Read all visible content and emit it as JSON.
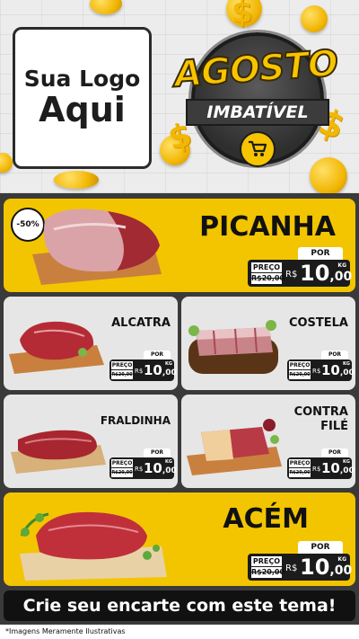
{
  "logo": {
    "line1": "Sua Logo",
    "line2": "Aqui"
  },
  "badge": {
    "title": "AGOSTO",
    "subtitle": "IMBATÍVEL",
    "icon": "shopping-cart-icon"
  },
  "labels": {
    "por": "POR",
    "preco": "PREÇO",
    "currency": "R$",
    "unit": "KG"
  },
  "colors": {
    "accent": "#f2c500",
    "dark": "#1b1b1b",
    "light_card": "#e6e6e6"
  },
  "featured": [
    {
      "name": "PICANHA",
      "discount": "-50%",
      "old_price": "R$20,00",
      "price_int": "10",
      "price_dec": ",00"
    },
    {
      "name": "ACÉM",
      "old_price": "R$20,00",
      "price_int": "10",
      "price_dec": ",00"
    }
  ],
  "products": [
    {
      "name": "ALCATRA",
      "old_price": "R$20,00",
      "price_int": "10",
      "price_dec": ",00"
    },
    {
      "name": "COSTELA",
      "old_price": "R$20,00",
      "price_int": "10",
      "price_dec": ",00"
    },
    {
      "name": "FRALDINHA",
      "old_price": "R$20,00",
      "price_int": "10",
      "price_dec": ",00"
    },
    {
      "name_l1": "CONTRA",
      "name_l2": "FILÉ",
      "old_price": "R$20,00",
      "price_int": "10",
      "price_dec": ",00"
    }
  ],
  "cta": "Crie seu encarte com este tema!",
  "footer": "*Imagens Meramente Ilustrativas"
}
